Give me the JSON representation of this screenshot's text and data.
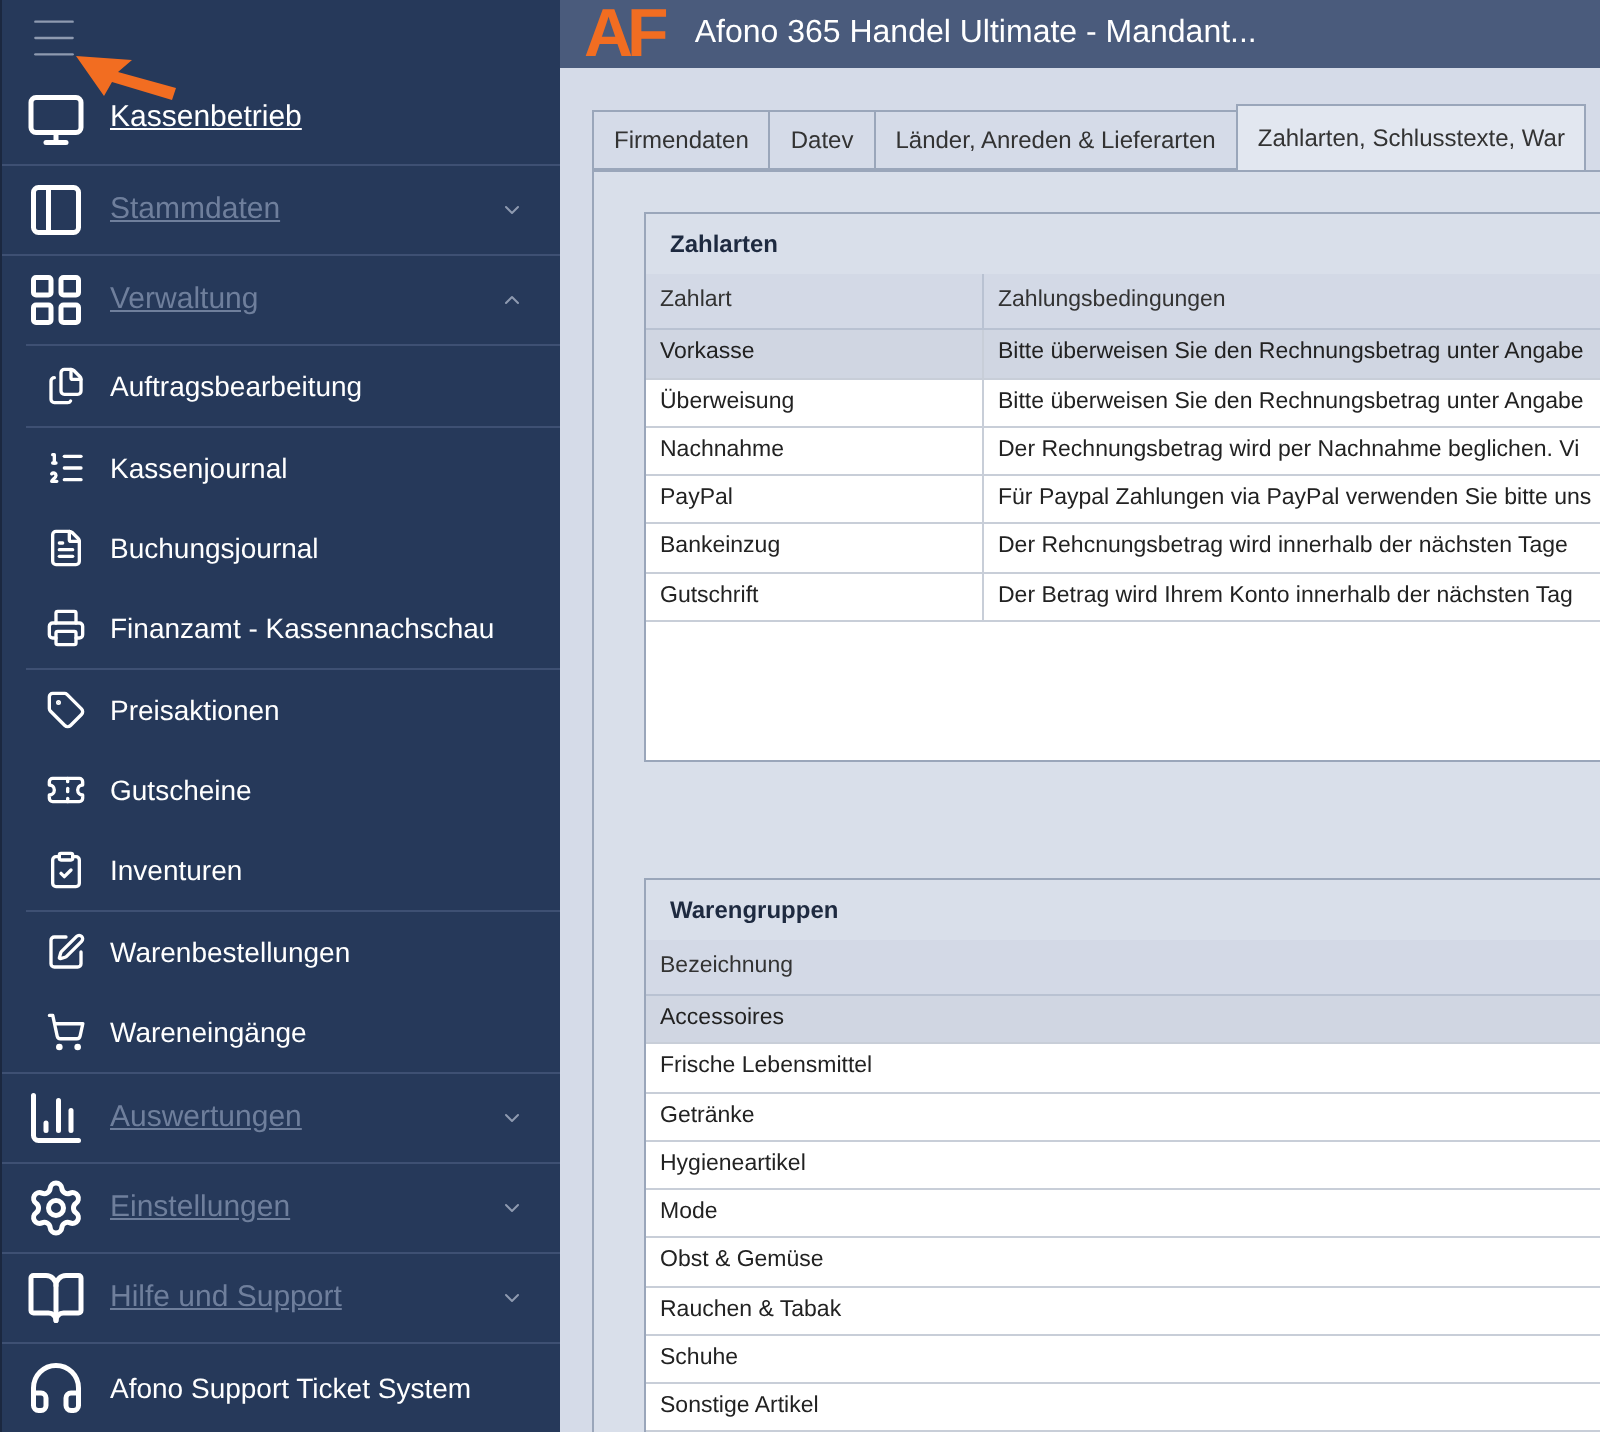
{
  "sidebar": {
    "items": [
      {
        "label": "Kassenbetrieb",
        "kind": "link"
      },
      {
        "label": "Stammdaten",
        "kind": "group",
        "expanded": false
      },
      {
        "label": "Verwaltung",
        "kind": "group",
        "expanded": true,
        "children": [
          {
            "items": [
              "Auftragsbearbeitung"
            ]
          },
          {
            "items": [
              "Kassenjournal",
              "Buchungsjournal",
              "Finanzamt - Kassennachschau"
            ]
          },
          {
            "items": [
              "Preisaktionen",
              "Gutscheine",
              "Inventuren"
            ]
          },
          {
            "items": [
              "Warenbestellungen",
              "Wareneingänge"
            ]
          }
        ]
      },
      {
        "label": "Auswertungen",
        "kind": "group",
        "expanded": false
      },
      {
        "label": "Einstellungen",
        "kind": "group",
        "expanded": false
      },
      {
        "label": "Hilfe und Support",
        "kind": "group",
        "expanded": false
      },
      {
        "label": "Afono Support Ticket System",
        "kind": "plain"
      }
    ]
  },
  "header": {
    "logo": "AF",
    "title": "Afono 365 Handel Ultimate - Mandant..."
  },
  "tabs": [
    {
      "label": "Firmendaten",
      "selected": false
    },
    {
      "label": "Datev",
      "selected": false
    },
    {
      "label": "Länder, Anreden & Lieferarten",
      "selected": false
    },
    {
      "label": "Zahlarten, Schlusstexte, War",
      "selected": true
    }
  ],
  "payment_methods": {
    "title": "Zahlarten",
    "columns": [
      "Zahlart",
      "Zahlungsbedingungen"
    ],
    "rows": [
      {
        "cells": [
          "Vorkasse",
          "Bitte überweisen Sie den Rechnungsbetrag unter Angabe"
        ],
        "selected": true
      },
      {
        "cells": [
          "Überweisung",
          "Bitte überweisen Sie den Rechnungsbetrag unter Angabe"
        ],
        "selected": false
      },
      {
        "cells": [
          "Nachnahme",
          "Der Rechnungsbetrag wird per Nachnahme beglichen. Vi"
        ],
        "selected": false
      },
      {
        "cells": [
          "PayPal",
          "Für Paypal Zahlungen via PayPal verwenden Sie bitte uns"
        ],
        "selected": false
      },
      {
        "cells": [
          "Bankeinzug",
          "Der Rehcnungsbetrag wird innerhalb der nächsten Tage"
        ],
        "selected": false
      },
      {
        "cells": [
          "Gutschrift",
          "Der Betrag wird Ihrem Konto innerhalb der nächsten Tag"
        ],
        "selected": false
      }
    ]
  },
  "product_groups": {
    "title": "Warengruppen",
    "columns": [
      "Bezeichnung"
    ],
    "rows": [
      {
        "cells": [
          "Accessoires"
        ],
        "selected": true
      },
      {
        "cells": [
          "Frische Lebensmittel"
        ],
        "selected": false
      },
      {
        "cells": [
          "Getränke"
        ],
        "selected": false
      },
      {
        "cells": [
          "Hygieneartikel"
        ],
        "selected": false
      },
      {
        "cells": [
          "Mode"
        ],
        "selected": false
      },
      {
        "cells": [
          "Obst & Gemüse"
        ],
        "selected": false
      },
      {
        "cells": [
          "Rauchen & Tabak"
        ],
        "selected": false
      },
      {
        "cells": [
          "Schuhe"
        ],
        "selected": false
      },
      {
        "cells": [
          "Sonstige Artikel"
        ],
        "selected": false
      }
    ]
  }
}
